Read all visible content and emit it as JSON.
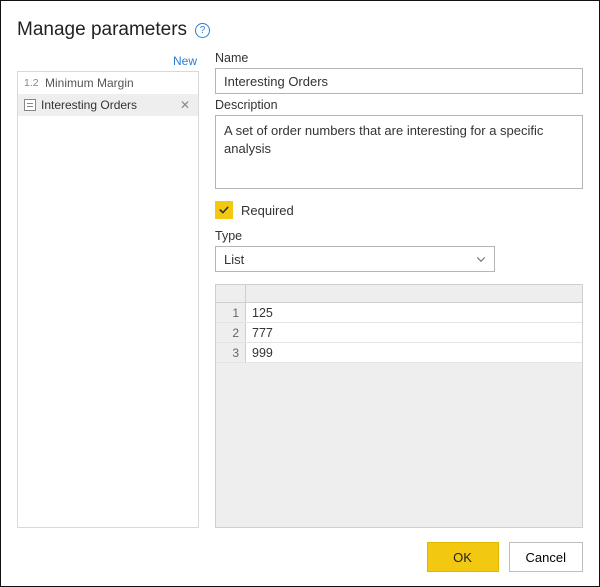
{
  "header": {
    "title": "Manage parameters",
    "help_tooltip": "?"
  },
  "sidebar": {
    "new_link": "New",
    "items": [
      {
        "badge": "1.2",
        "icon": "decimal-icon",
        "label": "Minimum Margin",
        "selected": false
      },
      {
        "badge": "",
        "icon": "list-icon",
        "label": "Interesting Orders",
        "selected": true
      }
    ]
  },
  "form": {
    "name_label": "Name",
    "name_value": "Interesting Orders",
    "description_label": "Description",
    "description_value": "A set of order numbers that are interesting for a specific analysis",
    "required_label": "Required",
    "required_checked": true,
    "type_label": "Type",
    "type_value": "List"
  },
  "grid": {
    "rows": [
      {
        "n": "1",
        "value": "125"
      },
      {
        "n": "2",
        "value": "777"
      },
      {
        "n": "3",
        "value": "999"
      }
    ]
  },
  "footer": {
    "ok_label": "OK",
    "cancel_label": "Cancel"
  }
}
